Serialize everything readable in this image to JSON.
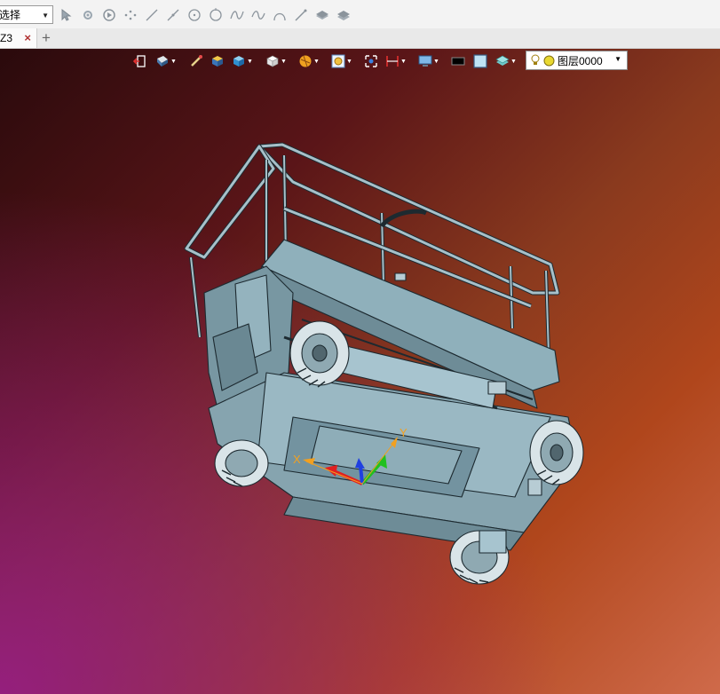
{
  "toolbar": {
    "filter_select": "选择",
    "tools": [
      "pointer-icon",
      "filter-gear-icon",
      "play-icon",
      "scatter-points-icon",
      "line-icon",
      "slanted-line-icon",
      "circle-icon",
      "circle-alt-icon",
      "spline-icon",
      "wave-curve-icon",
      "arc-icon",
      "pen-icon",
      "surface-layer-icon",
      "stack-layer-icon"
    ]
  },
  "tabs": {
    "items": [
      {
        "label": "Z3",
        "close_label": "×"
      }
    ],
    "add_label": "+"
  },
  "view_toolbar": {
    "items": [
      "exit-view-icon",
      "render-mode-icon",
      "measure-icon",
      "solid-box-icon",
      "shaded-cube-icon",
      "wire-cube-icon",
      "sphere-icon",
      "zoom-fit-icon",
      "snapshot-icon",
      "dimension-icon",
      "display-monitor-icon",
      "black-color-swatch",
      "light-blue-swatch",
      "cube-stack-icon"
    ],
    "layer_select": "图层0000"
  },
  "triad": {
    "x_label": "X",
    "y_label": "Y"
  },
  "colors": {
    "background_top_right": "#b0461c",
    "background_bottom_left": "#961e82",
    "model_fill": "#7f9ca7",
    "model_edge": "#1d2a30",
    "axis_x": "#e02020",
    "axis_y": "#20c020",
    "axis_z": "#2040e0",
    "axis_label": "#f2a020"
  }
}
